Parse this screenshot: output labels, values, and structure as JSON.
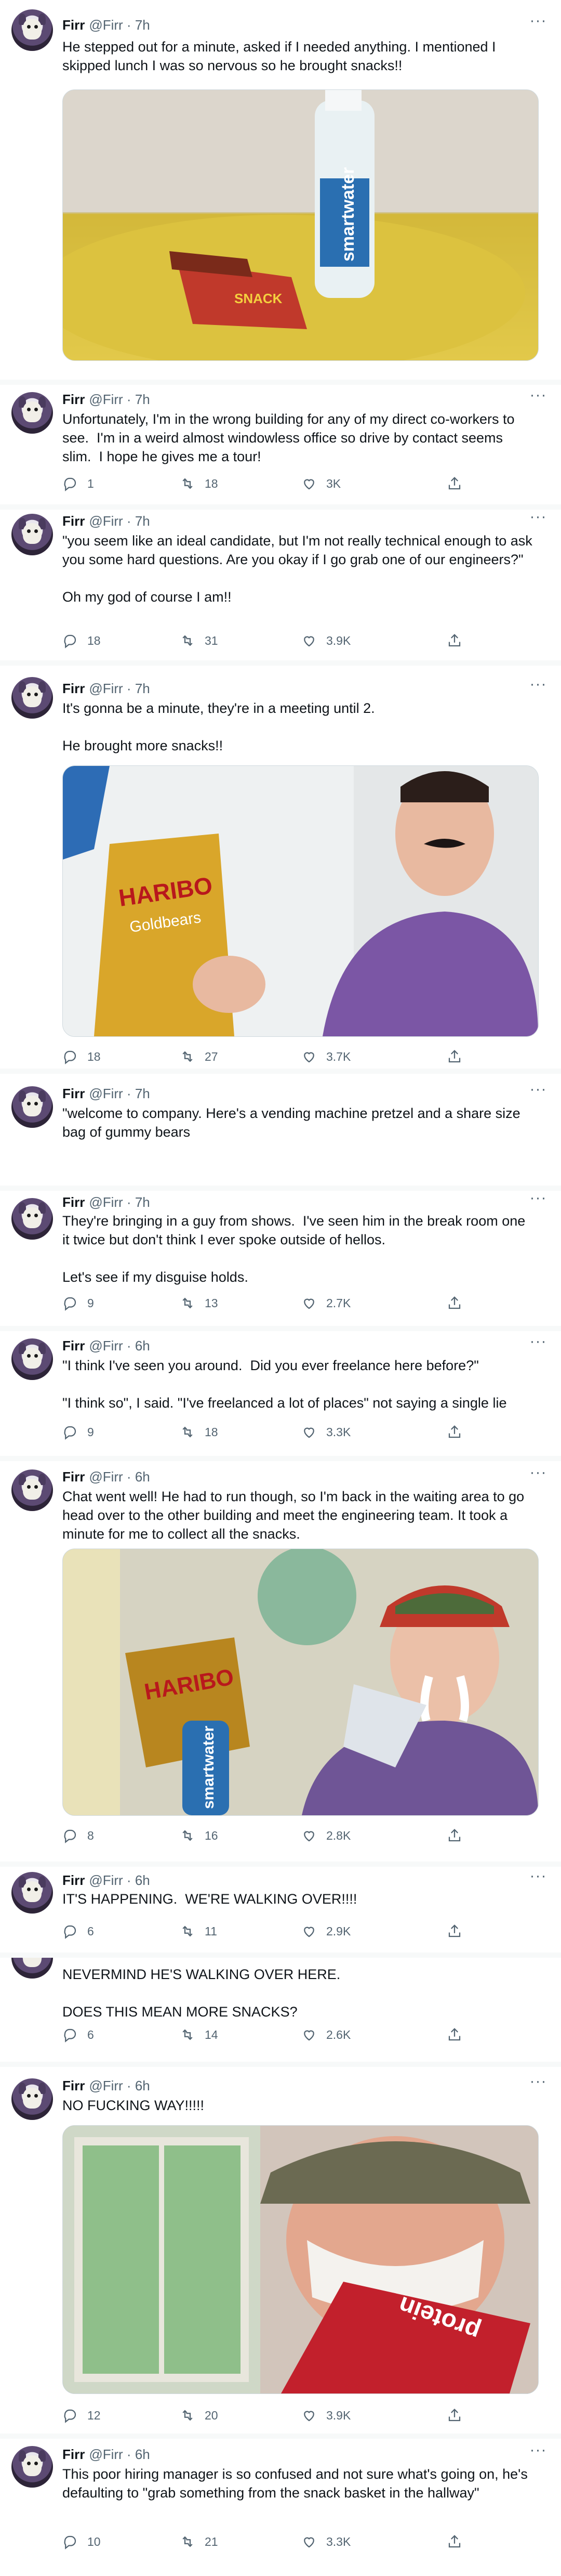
{
  "tweets": [
    {
      "name": "Firr",
      "handle": "@Firr · 7h",
      "text": "He stepped out for a minute, asked if I needed anything. I mentioned I skipped lunch I was so nervous so he brought snacks!!",
      "replies": "",
      "retweets": "",
      "likes": ""
    },
    {
      "name": "Firr",
      "handle": "@Firr · 7h",
      "text": "Unfortunately, I'm in the wrong building for any of my direct co-workers to see.  I'm in a weird almost windowless office so drive by contact seems slim.  I hope he gives me a tour!",
      "replies": "1",
      "retweets": "18",
      "likes": "3K"
    },
    {
      "name": "Firr",
      "handle": "@Firr · 7h",
      "text": "\"you seem like an ideal candidate, but I'm not really technical enough to ask you some hard questions. Are you okay if I go grab one of our engineers?\"\n\nOh my god of course I am!!",
      "replies": "18",
      "retweets": "31",
      "likes": "3.9K"
    },
    {
      "name": "Firr",
      "handle": "@Firr · 7h",
      "text": "It's gonna be a minute, they're in a meeting until 2.\n\nHe brought more snacks!!",
      "replies": "18",
      "retweets": "27",
      "likes": "3.7K"
    },
    {
      "name": "Firr",
      "handle": "@Firr · 7h",
      "text": "\"welcome to company. Here's a vending machine pretzel and a share size bag of gummy bears",
      "replies": "",
      "retweets": "",
      "likes": ""
    },
    {
      "name": "Firr",
      "handle": "@Firr · 7h",
      "text": "They're bringing in a guy from shows.  I've seen him in the break room one it twice but don't think I ever spoke outside of hellos.\n\nLet's see if my disguise holds.",
      "replies": "9",
      "retweets": "13",
      "likes": "2.7K"
    },
    {
      "name": "Firr",
      "handle": "@Firr · 6h",
      "text": "\"I think I've seen you around.  Did you ever freelance here before?\"\n\n\"I think so\", I said. \"I've freelanced a lot of places\" not saying a single lie",
      "replies": "9",
      "retweets": "18",
      "likes": "3.3K"
    },
    {
      "name": "Firr",
      "handle": "@Firr · 6h",
      "text": "Chat went well! He had to run though, so I'm back in the waiting area to go head over to the other building and meet the engineering team. It took a minute for me to collect all the snacks.",
      "replies": "8",
      "retweets": "16",
      "likes": "2.8K"
    },
    {
      "name": "Firr",
      "handle": "@Firr · 6h",
      "text": "IT'S HAPPENING.  WE'RE WALKING OVER!!!!",
      "replies": "6",
      "retweets": "11",
      "likes": "2.9K"
    },
    {
      "name": "",
      "handle": "",
      "text": "NEVERMIND HE'S WALKING OVER HERE.\n\nDOES THIS MEAN MORE SNACKS?",
      "replies": "6",
      "retweets": "14",
      "likes": "2.6K"
    },
    {
      "name": "Firr",
      "handle": "@Firr · 6h",
      "text": "NO FUCKING WAY!!!!!",
      "replies": "12",
      "retweets": "20",
      "likes": "3.9K"
    },
    {
      "name": "Firr",
      "handle": "@Firr · 6h",
      "text": "This poor hiring manager is so confused and not sure what's going on, he's defaulting to \"grab something from the snack basket in the hallway\"",
      "replies": "10",
      "retweets": "21",
      "likes": "3.3K"
    }
  ],
  "media": {
    "water_label": "smartwater",
    "chips_label": "SNACK",
    "bag_label_1": "HARIBO",
    "bag_label_2": "Goldbears",
    "bag_label_3": "HARIBO",
    "water_label_2": "smartwater",
    "protein_label": "protein"
  },
  "icons": [
    "avatar",
    "more-icon",
    "reply-icon",
    "retweet-icon",
    "like-icon",
    "share-icon"
  ],
  "colors": {
    "text": "#0f1419",
    "secondary": "#536471",
    "thread": "#cfd9de",
    "separator": "#f7f9f9"
  }
}
